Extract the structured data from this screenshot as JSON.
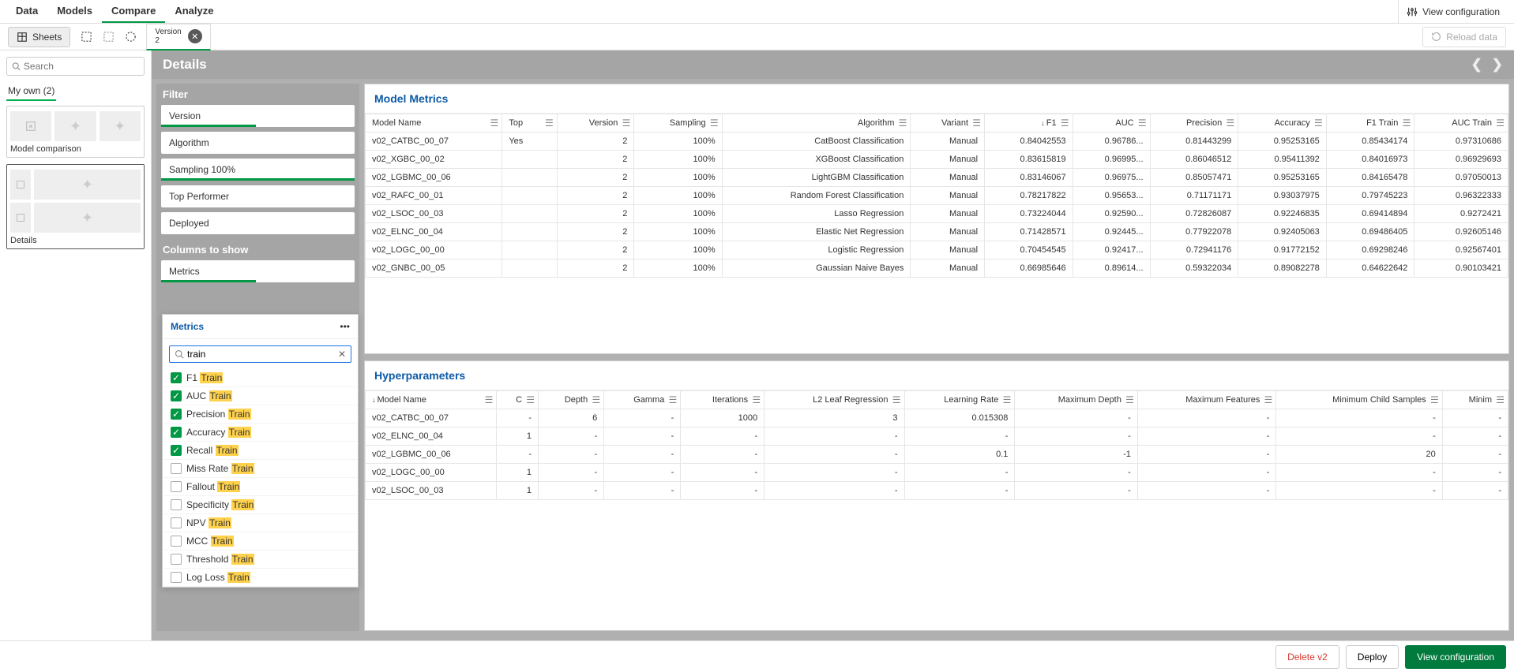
{
  "top_tabs": [
    "Data",
    "Models",
    "Compare",
    "Analyze"
  ],
  "top_active_tab": "Compare",
  "view_configuration": "View configuration",
  "sheets_button": "Sheets",
  "version_tab": {
    "label": "Version",
    "value": "2"
  },
  "reload": "Reload data",
  "search_placeholder": "Search",
  "my_own_label": "My own (2)",
  "thumb_cards": [
    {
      "caption": "Model comparison"
    },
    {
      "caption": "Details"
    }
  ],
  "details_title": "Details",
  "filters": {
    "header": "Filter",
    "items": [
      {
        "label": "Version",
        "activeWidth": "half"
      },
      {
        "label": "Algorithm"
      },
      {
        "label": "Sampling 100%",
        "activeWidth": "full"
      },
      {
        "label": "Top Performer"
      },
      {
        "label": "Deployed"
      }
    ]
  },
  "columns_section": {
    "header": "Columns to show",
    "pill": {
      "label": "Metrics",
      "activeWidth": "half"
    }
  },
  "metrics_popup": {
    "title": "Metrics",
    "search_value": "train",
    "options": [
      {
        "prefix": "F1 ",
        "hl": "Train",
        "checked": true
      },
      {
        "prefix": "AUC ",
        "hl": "Train",
        "checked": true
      },
      {
        "prefix": "Precision ",
        "hl": "Train",
        "checked": true
      },
      {
        "prefix": "Accuracy ",
        "hl": "Train",
        "checked": true
      },
      {
        "prefix": "Recall ",
        "hl": "Train",
        "checked": true
      },
      {
        "prefix": "Miss Rate ",
        "hl": "Train",
        "checked": false
      },
      {
        "prefix": "Fallout ",
        "hl": "Train",
        "checked": false
      },
      {
        "prefix": "Specificity ",
        "hl": "Train",
        "checked": false
      },
      {
        "prefix": "NPV ",
        "hl": "Train",
        "checked": false
      },
      {
        "prefix": "MCC ",
        "hl": "Train",
        "checked": false
      },
      {
        "prefix": "Threshold ",
        "hl": "Train",
        "checked": false
      },
      {
        "prefix": "Log Loss ",
        "hl": "Train",
        "checked": false
      }
    ]
  },
  "model_metrics": {
    "title": "Model Metrics",
    "columns": [
      "Model Name",
      "Top",
      "Version",
      "Sampling",
      "Algorithm",
      "Variant",
      "F1",
      "AUC",
      "Precision",
      "Accuracy",
      "F1 Train",
      "AUC Train"
    ],
    "sort_col": "F1",
    "rows": [
      [
        "v02_CATBC_00_07",
        "Yes",
        "2",
        "100%",
        "CatBoost Classification",
        "Manual",
        "0.84042553",
        "0.96786...",
        "0.81443299",
        "0.95253165",
        "0.85434174",
        "0.97310686"
      ],
      [
        "v02_XGBC_00_02",
        "",
        "2",
        "100%",
        "XGBoost Classification",
        "Manual",
        "0.83615819",
        "0.96995...",
        "0.86046512",
        "0.95411392",
        "0.84016973",
        "0.96929693"
      ],
      [
        "v02_LGBMC_00_06",
        "",
        "2",
        "100%",
        "LightGBM Classification",
        "Manual",
        "0.83146067",
        "0.96975...",
        "0.85057471",
        "0.95253165",
        "0.84165478",
        "0.97050013"
      ],
      [
        "v02_RAFC_00_01",
        "",
        "2",
        "100%",
        "Random Forest Classification",
        "Manual",
        "0.78217822",
        "0.95653...",
        "0.71171171",
        "0.93037975",
        "0.79745223",
        "0.96322333"
      ],
      [
        "v02_LSOC_00_03",
        "",
        "2",
        "100%",
        "Lasso Regression",
        "Manual",
        "0.73224044",
        "0.92590...",
        "0.72826087",
        "0.92246835",
        "0.69414894",
        "0.9272421"
      ],
      [
        "v02_ELNC_00_04",
        "",
        "2",
        "100%",
        "Elastic Net Regression",
        "Manual",
        "0.71428571",
        "0.92445...",
        "0.77922078",
        "0.92405063",
        "0.69486405",
        "0.92605146"
      ],
      [
        "v02_LOGC_00_00",
        "",
        "2",
        "100%",
        "Logistic Regression",
        "Manual",
        "0.70454545",
        "0.92417...",
        "0.72941176",
        "0.91772152",
        "0.69298246",
        "0.92567401"
      ],
      [
        "v02_GNBC_00_05",
        "",
        "2",
        "100%",
        "Gaussian Naive Bayes",
        "Manual",
        "0.66985646",
        "0.89614...",
        "0.59322034",
        "0.89082278",
        "0.64622642",
        "0.90103421"
      ]
    ]
  },
  "hyperparameters": {
    "title": "Hyperparameters",
    "columns": [
      "Model Name",
      "C",
      "Depth",
      "Gamma",
      "Iterations",
      "L2 Leaf Regression",
      "Learning Rate",
      "Maximum Depth",
      "Maximum Features",
      "Minimum Child Samples",
      "Minim"
    ],
    "sort_col": "Model Name",
    "rows": [
      [
        "v02_CATBC_00_07",
        "-",
        "6",
        "-",
        "1000",
        "3",
        "0.015308",
        "-",
        "-",
        "-",
        "-"
      ],
      [
        "v02_ELNC_00_04",
        "1",
        "-",
        "-",
        "-",
        "-",
        "-",
        "-",
        "-",
        "-",
        "-"
      ],
      [
        "v02_LGBMC_00_06",
        "-",
        "-",
        "-",
        "-",
        "-",
        "0.1",
        "-1",
        "-",
        "20",
        "-"
      ],
      [
        "v02_LOGC_00_00",
        "1",
        "-",
        "-",
        "-",
        "-",
        "-",
        "-",
        "-",
        "-",
        "-"
      ],
      [
        "v02_LSOC_00_03",
        "1",
        "-",
        "-",
        "-",
        "-",
        "-",
        "-",
        "-",
        "-",
        "-"
      ]
    ]
  },
  "footer": {
    "delete": "Delete v2",
    "deploy": "Deploy",
    "view_configuration": "View configuration"
  }
}
